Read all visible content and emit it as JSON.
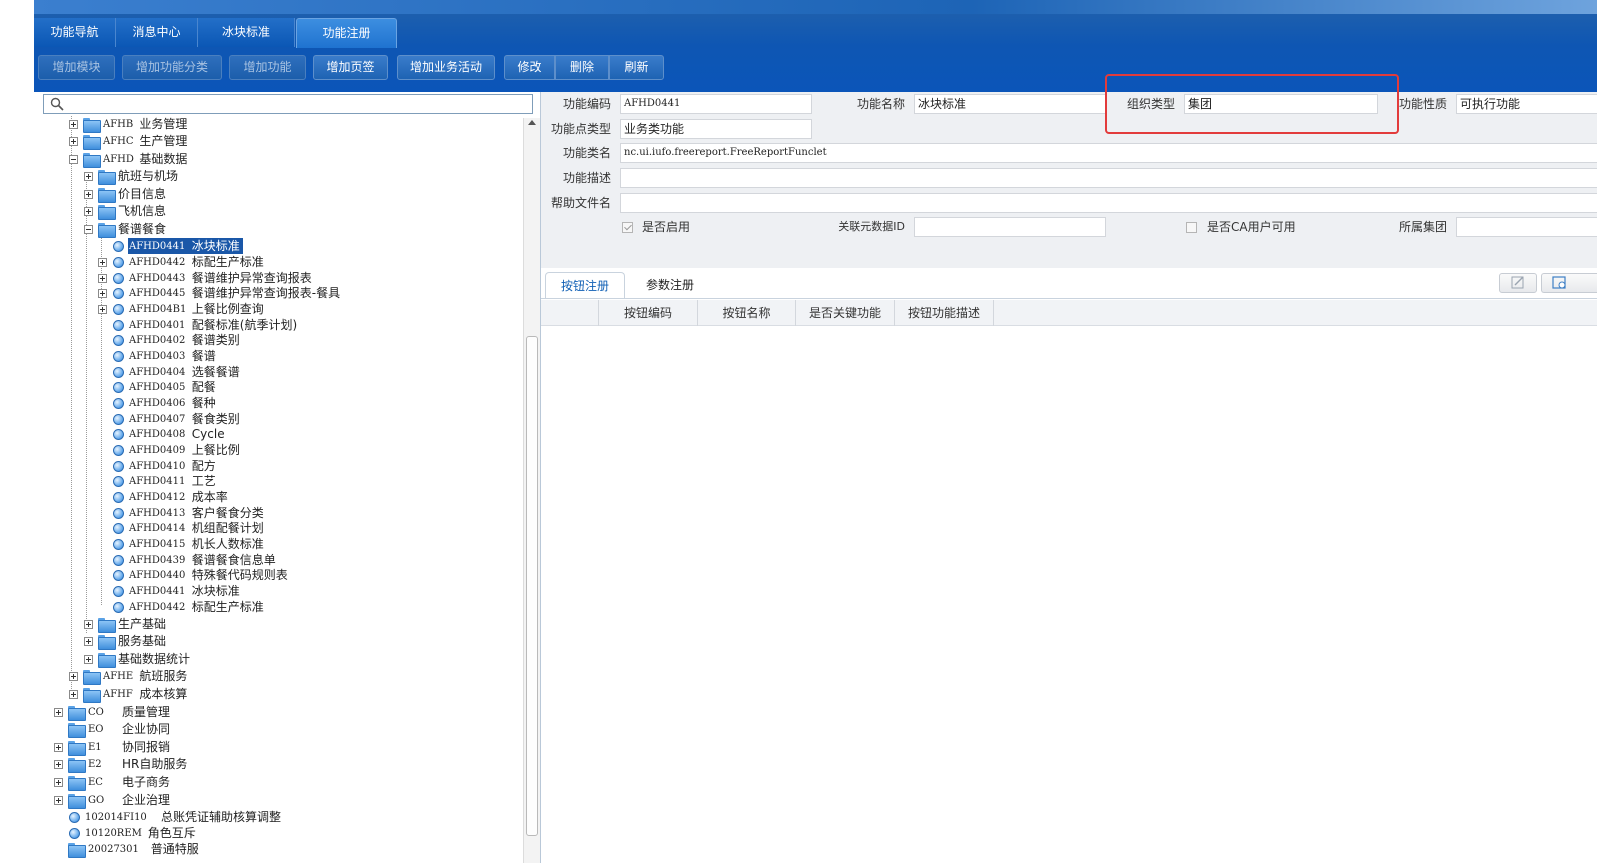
{
  "tabs": [
    {
      "label": "功能导航"
    },
    {
      "label": "消息中心"
    },
    {
      "label": "冰块标准"
    },
    {
      "label": "功能注册"
    }
  ],
  "toolbar": {
    "add_module": "增加模块",
    "add_category": "增加功能分类",
    "add_function": "增加功能",
    "add_page_tab": "增加页签",
    "add_business_activity": "增加业务活动",
    "modify": "修改",
    "delete": "删除",
    "refresh": "刷新"
  },
  "search": {
    "placeholder": "",
    "value": ""
  },
  "tree": [
    {
      "code": "AFHB",
      "label": "业务管理",
      "expander": "plus",
      "icon": "folder"
    },
    {
      "code": "AFHC",
      "label": "生产管理",
      "expander": "plus",
      "icon": "folder"
    },
    {
      "code": "AFHD",
      "label": "基础数据",
      "expander": "minus",
      "icon": "folder"
    },
    {
      "code": "",
      "label": "航班与机场",
      "expander": "plus",
      "icon": "folder"
    },
    {
      "code": "",
      "label": "价目信息",
      "expander": "plus",
      "icon": "folder"
    },
    {
      "code": "",
      "label": "飞机信息",
      "expander": "plus",
      "icon": "folder"
    },
    {
      "code": "",
      "label": "餐谱餐食",
      "expander": "minus",
      "icon": "folder"
    },
    {
      "code": "AFHD0441",
      "label": "冰块标准",
      "expander": "none",
      "icon": "leaf",
      "selected": true
    },
    {
      "code": "AFHD0442",
      "label": "标配生产标准",
      "expander": "plus",
      "icon": "leaf"
    },
    {
      "code": "AFHD0443",
      "label": "餐谱维护异常查询报表",
      "expander": "plus",
      "icon": "leaf"
    },
    {
      "code": "AFHD0445",
      "label": "餐谱维护异常查询报表-餐具",
      "expander": "plus",
      "icon": "leaf"
    },
    {
      "code": "AFHD04B1",
      "label": "上餐比例查询",
      "expander": "plus",
      "icon": "leaf"
    },
    {
      "code": "AFHD0401",
      "label": "配餐标准(航季计划)",
      "expander": "none",
      "icon": "leaf"
    },
    {
      "code": "AFHD0402",
      "label": "餐谱类别",
      "expander": "none",
      "icon": "leaf"
    },
    {
      "code": "AFHD0403",
      "label": "餐谱",
      "expander": "none",
      "icon": "leaf"
    },
    {
      "code": "AFHD0404",
      "label": "选餐餐谱",
      "expander": "none",
      "icon": "leaf"
    },
    {
      "code": "AFHD0405",
      "label": "配餐",
      "expander": "none",
      "icon": "leaf"
    },
    {
      "code": "AFHD0406",
      "label": "餐种",
      "expander": "none",
      "icon": "leaf"
    },
    {
      "code": "AFHD0407",
      "label": "餐食类别",
      "expander": "none",
      "icon": "leaf"
    },
    {
      "code": "AFHD0408",
      "label": "Cycle",
      "expander": "none",
      "icon": "leaf"
    },
    {
      "code": "AFHD0409",
      "label": "上餐比例",
      "expander": "none",
      "icon": "leaf"
    },
    {
      "code": "AFHD0410",
      "label": "配方",
      "expander": "none",
      "icon": "leaf"
    },
    {
      "code": "AFHD0411",
      "label": "工艺",
      "expander": "none",
      "icon": "leaf"
    },
    {
      "code": "AFHD0412",
      "label": "成本率",
      "expander": "none",
      "icon": "leaf"
    },
    {
      "code": "AFHD0413",
      "label": "客户餐食分类",
      "expander": "none",
      "icon": "leaf"
    },
    {
      "code": "AFHD0414",
      "label": "机组配餐计划",
      "expander": "none",
      "icon": "leaf"
    },
    {
      "code": "AFHD0415",
      "label": "机长人数标准",
      "expander": "none",
      "icon": "leaf"
    },
    {
      "code": "AFHD0439",
      "label": "餐谱餐食信息单",
      "expander": "none",
      "icon": "leaf"
    },
    {
      "code": "AFHD0440",
      "label": "特殊餐代码规则表",
      "expander": "none",
      "icon": "leaf"
    },
    {
      "code": "AFHD0441",
      "label": "冰块标准",
      "expander": "none",
      "icon": "leaf"
    },
    {
      "code": "AFHD0442",
      "label": "标配生产标准",
      "expander": "none",
      "icon": "leaf"
    },
    {
      "code": "",
      "label": "生产基础",
      "expander": "plus",
      "icon": "folder"
    },
    {
      "code": "",
      "label": "服务基础",
      "expander": "plus",
      "icon": "folder"
    },
    {
      "code": "",
      "label": "基础数据统计",
      "expander": "plus",
      "icon": "folder"
    },
    {
      "code": "AFHE",
      "label": "航班服务",
      "expander": "plus",
      "icon": "folder"
    },
    {
      "code": "AFHF",
      "label": "成本核算",
      "expander": "plus",
      "icon": "folder"
    },
    {
      "code": "CO",
      "label": "质量管理",
      "expander": "plus",
      "icon": "folder"
    },
    {
      "code": "EO",
      "label": "企业协同",
      "expander": "none",
      "icon": "folder"
    },
    {
      "code": "E1",
      "label": "协同报销",
      "expander": "plus",
      "icon": "folder"
    },
    {
      "code": "E2",
      "label": "HR自助服务",
      "expander": "plus",
      "icon": "folder"
    },
    {
      "code": "EC",
      "label": "电子商务",
      "expander": "plus",
      "icon": "folder"
    },
    {
      "code": "GO",
      "label": "企业治理",
      "expander": "plus",
      "icon": "folder"
    },
    {
      "code": "102014FI10",
      "label": "总账凭证辅助核算调整",
      "expander": "none",
      "icon": "leaf"
    },
    {
      "code": "10120REM",
      "label": "角色互斥",
      "expander": "none",
      "icon": "leaf"
    },
    {
      "code": "20027301",
      "label": "普通特服",
      "expander": "none",
      "icon": "folder"
    }
  ],
  "form": {
    "func_code_label": "功能编码",
    "func_code": "AFHD0441",
    "func_name_label": "功能名称",
    "func_name": "冰块标准",
    "org_type_label": "组织类型",
    "org_type": "集团",
    "func_nature_label": "功能性质",
    "func_nature": "可执行功能",
    "func_point_type_label": "功能点类型",
    "func_point_type": "业务类功能",
    "func_class_label": "功能类名",
    "func_class": "nc.ui.iufo.freereport.FreeReportFunclet",
    "func_desc_label": "功能描述",
    "func_desc": "",
    "help_file_label": "帮助文件名",
    "help_file": "",
    "enabled_label": "是否启用",
    "enabled": true,
    "meta_id_label": "关联元数据ID",
    "meta_id": "",
    "ca_user_label": "是否CA用户可用",
    "ca_user": false,
    "group_label": "所属集团",
    "group": ""
  },
  "subtabs": [
    {
      "label": "按钮注册"
    },
    {
      "label": "参数注册"
    }
  ],
  "table": {
    "columns": [
      "按钮编码",
      "按钮名称",
      "是否关键功能",
      "按钮功能描述"
    ],
    "rows": []
  },
  "colors": {
    "header_blue": "#0b55b9",
    "selection": "#1a57a8",
    "highlight_red": "#e23b3b"
  }
}
